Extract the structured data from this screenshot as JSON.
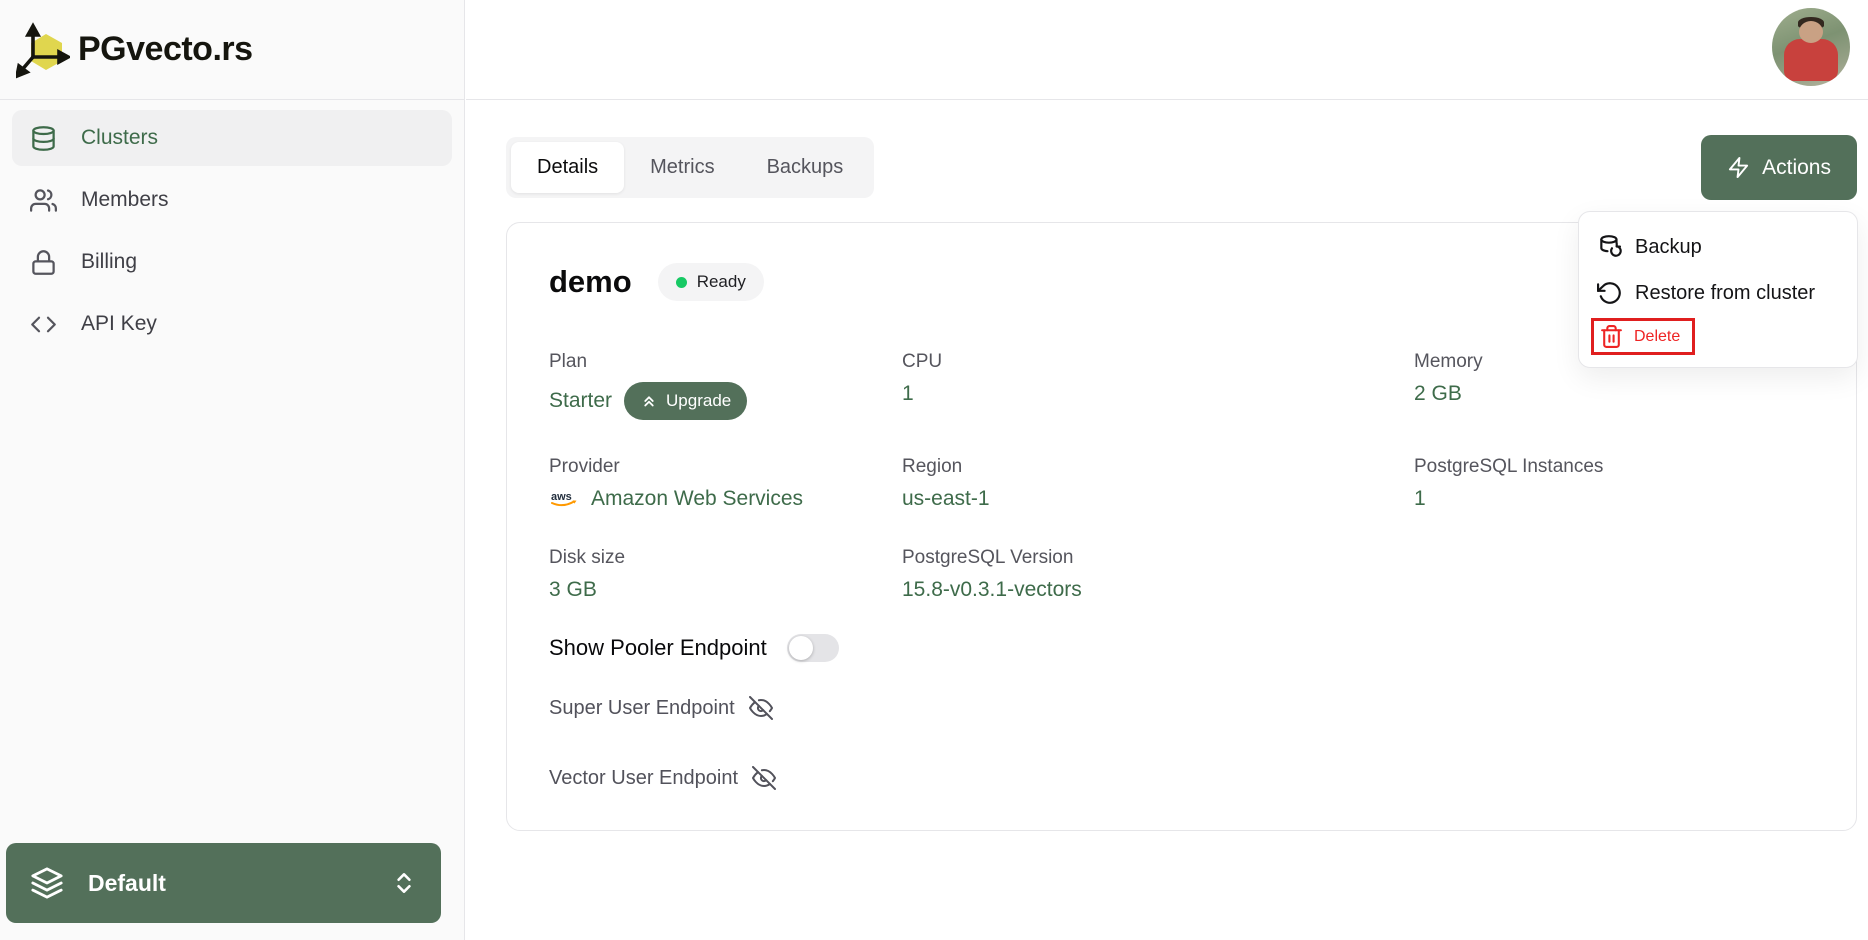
{
  "brand": {
    "name": "PGvecto.rs",
    "logo_icon": "axes-cube-logo-icon"
  },
  "sidebar": {
    "items": [
      {
        "label": "Clusters",
        "icon": "database-icon",
        "active": true
      },
      {
        "label": "Members",
        "icon": "users-icon",
        "active": false
      },
      {
        "label": "Billing",
        "icon": "lock-icon",
        "active": false
      },
      {
        "label": "API Key",
        "icon": "code-icon",
        "active": false
      }
    ],
    "workspace": {
      "label": "Default",
      "icon": "layers-icon",
      "chevron": "chevrons-up-down-icon"
    }
  },
  "tabs": {
    "items": [
      {
        "label": "Details",
        "active": true
      },
      {
        "label": "Metrics",
        "active": false
      },
      {
        "label": "Backups",
        "active": false
      }
    ]
  },
  "actions": {
    "button_label": "Actions",
    "button_icon": "lightning-bolt-icon",
    "menu": [
      {
        "label": "Backup",
        "icon": "database-backup-icon",
        "danger": false,
        "highlighted": false
      },
      {
        "label": "Restore from cluster",
        "icon": "rotate-ccw-icon",
        "danger": false,
        "highlighted": false
      },
      {
        "label": "Delete",
        "icon": "trash-icon",
        "danger": true,
        "highlighted": true
      }
    ]
  },
  "cluster": {
    "name": "demo",
    "status": "Ready",
    "plan": {
      "label": "Plan",
      "value": "Starter",
      "upgrade_label": "Upgrade"
    },
    "cpu": {
      "label": "CPU",
      "value": "1"
    },
    "memory": {
      "label": "Memory",
      "value": "2 GB"
    },
    "provider": {
      "label": "Provider",
      "value": "Amazon Web Services",
      "icon": "aws-logo-icon",
      "icon_text": "aws"
    },
    "region": {
      "label": "Region",
      "value": "us-east-1"
    },
    "instances": {
      "label": "PostgreSQL Instances",
      "value": "1"
    },
    "disk": {
      "label": "Disk size",
      "value": "3 GB"
    },
    "version": {
      "label": "PostgreSQL Version",
      "value": "15.8-v0.3.1-vectors"
    },
    "pooler_toggle": {
      "label": "Show Pooler Endpoint",
      "state": "off"
    },
    "endpoints": [
      {
        "label": "Super User Endpoint",
        "icon": "eye-off-icon",
        "visibility": "hidden"
      },
      {
        "label": "Vector User Endpoint",
        "icon": "eye-off-icon",
        "visibility": "hidden"
      }
    ]
  },
  "colors": {
    "accent_green": "#53705a",
    "value_green": "#3e6b4a",
    "ready_dot_green": "#17c964",
    "danger_red": "#ee2424",
    "highlight_box_red": "#e01f1f",
    "aws_orange": "#ff9900",
    "logo_yellow": "#e0d64e",
    "sidebar_bg": "#fafafa",
    "border_gray": "#e6e6e9"
  }
}
